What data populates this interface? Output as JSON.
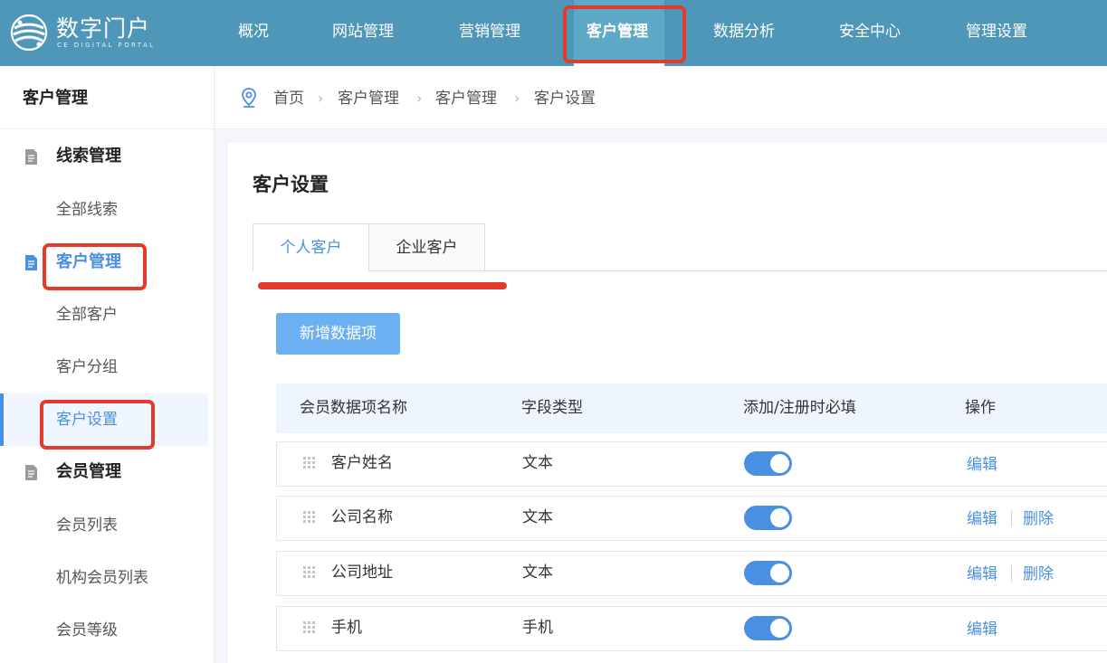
{
  "colors": {
    "topbar": "#4e97b8",
    "accent": "#4a90e2",
    "highlight": "#e23b2a",
    "button": "#6cb0f2",
    "table_header": "#eef5fd"
  },
  "header": {
    "logo_title": "数字门户",
    "logo_subtitle": "CE DIGITAL PORTAL",
    "nav": [
      "概况",
      "网站管理",
      "营销管理",
      "客户管理",
      "数据分析",
      "安全中心",
      "管理设置"
    ],
    "active_nav": "客户管理"
  },
  "sidebar": {
    "title": "客户管理",
    "groups": [
      {
        "label": "线索管理",
        "icon": "document-icon",
        "items": [
          "全部线索"
        ]
      },
      {
        "label": "客户管理",
        "icon": "document-icon",
        "items": [
          "全部客户",
          "客户分组",
          "客户设置"
        ]
      },
      {
        "label": "会员管理",
        "icon": "document-icon",
        "items": [
          "会员列表",
          "机构会员列表",
          "会员等级"
        ]
      }
    ],
    "active_item": "客户设置"
  },
  "breadcrumb": [
    "首页",
    "客户管理",
    "客户管理",
    "客户设置"
  ],
  "main": {
    "title": "客户设置",
    "tabs": [
      "个人客户",
      "企业客户"
    ],
    "active_tab": "个人客户",
    "add_button": "新增数据项",
    "table": {
      "columns": [
        "会员数据项名称",
        "字段类型",
        "添加/注册时必填",
        "操作"
      ],
      "rows": [
        {
          "name": "客户姓名",
          "type": "文本",
          "required": true,
          "actions": [
            "编辑"
          ]
        },
        {
          "name": "公司名称",
          "type": "文本",
          "required": true,
          "actions": [
            "编辑",
            "删除"
          ]
        },
        {
          "name": "公司地址",
          "type": "文本",
          "required": true,
          "actions": [
            "编辑",
            "删除"
          ]
        },
        {
          "name": "手机",
          "type": "手机",
          "required": true,
          "actions": [
            "编辑"
          ]
        }
      ]
    }
  }
}
